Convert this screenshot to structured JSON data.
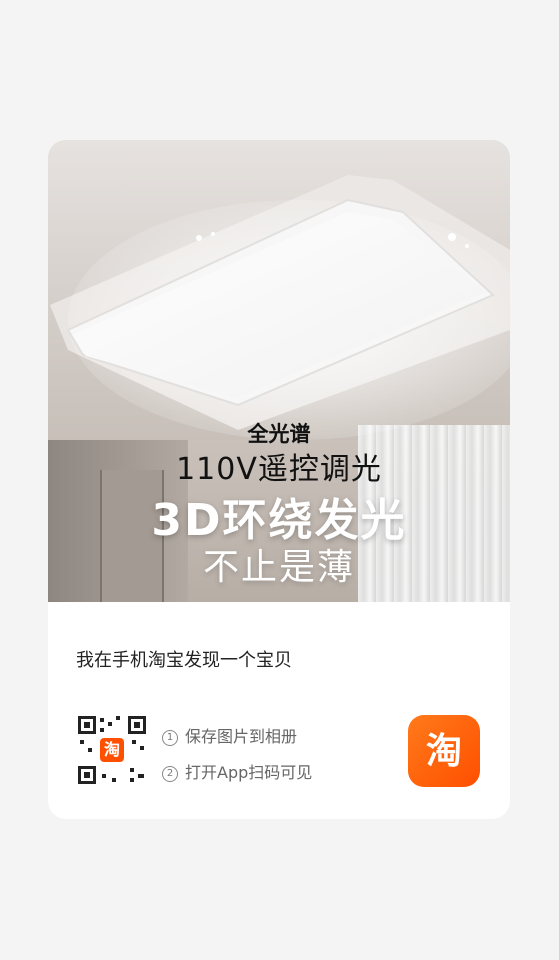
{
  "product_image": {
    "line1": "全光谱",
    "line2": "110V遥控调光",
    "line3": "3D环绕发光",
    "line4": "不止是薄"
  },
  "share": {
    "headline": "我在手机淘宝发现一个宝贝",
    "steps": [
      {
        "num": "①",
        "text": "保存图片到相册"
      },
      {
        "num": "②",
        "text": "打开App扫码可见"
      }
    ],
    "qr_center_label": "淘",
    "app_icon_label": "淘"
  },
  "colors": {
    "brand_orange": "#ff5000",
    "card_bg": "#ffffff",
    "page_bg": "#f4f4f4"
  }
}
